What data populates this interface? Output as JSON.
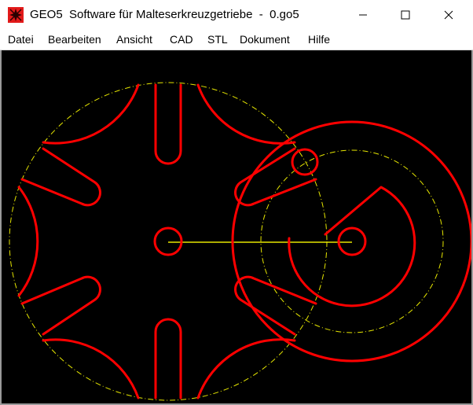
{
  "window": {
    "title": "GEO5  Software für Malteserkreuzgetriebe  -  0.go5",
    "controls": {
      "minimize_icon": "minimize-icon",
      "maximize_icon": "maximize-icon",
      "close_icon": "close-icon"
    }
  },
  "menu": {
    "items": [
      {
        "label": "Datei"
      },
      {
        "label": "Bearbeiten"
      },
      {
        "label": "Ansicht"
      },
      {
        "label": "CAD"
      },
      {
        "label": "STL"
      },
      {
        "label": "Dokument"
      },
      {
        "label": "Hilfe"
      }
    ]
  },
  "drawing": {
    "background": "#000000",
    "geometry_color": "#ff0000",
    "construction_color": "#ffff00"
  }
}
